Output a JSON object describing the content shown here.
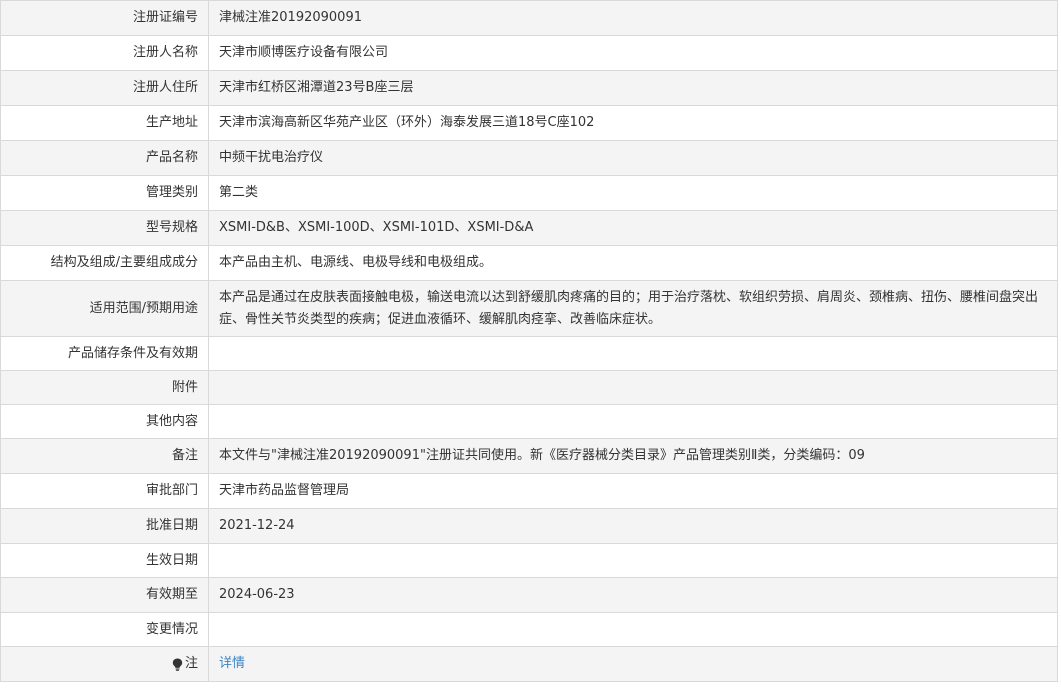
{
  "rows": [
    {
      "label": "注册证编号",
      "value": "津械注准20192090091"
    },
    {
      "label": "注册人名称",
      "value": "天津市顺博医疗设备有限公司"
    },
    {
      "label": "注册人住所",
      "value": "天津市红桥区湘潭道23号B座三层"
    },
    {
      "label": "生产地址",
      "value": "天津市滨海高新区华苑产业区（环外）海泰发展三道18号C座102"
    },
    {
      "label": "产品名称",
      "value": "中频干扰电治疗仪"
    },
    {
      "label": "管理类别",
      "value": "第二类"
    },
    {
      "label": "型号规格",
      "value": "XSMI-D&B、XSMI-100D、XSMI-101D、XSMI-D&A"
    },
    {
      "label": "结构及组成/主要组成成分",
      "value": "本产品由主机、电源线、电极导线和电极组成。"
    },
    {
      "label": "适用范围/预期用途",
      "value": "本产品是通过在皮肤表面接触电极，输送电流以达到舒缓肌肉疼痛的目的；用于治疗落枕、软组织劳损、肩周炎、颈椎病、扭伤、腰椎间盘突出症、骨性关节炎类型的疾病；促进血液循环、缓解肌肉痉挛、改善临床症状。"
    },
    {
      "label": "产品储存条件及有效期",
      "value": ""
    },
    {
      "label": "附件",
      "value": ""
    },
    {
      "label": "其他内容",
      "value": ""
    },
    {
      "label": "备注",
      "value": "本文件与\"津械注准20192090091\"注册证共同使用。新《医疗器械分类目录》产品管理类别Ⅱ类，分类编码：09"
    },
    {
      "label": "审批部门",
      "value": "天津市药品监督管理局"
    },
    {
      "label": "批准日期",
      "value": "2021-12-24"
    },
    {
      "label": "生效日期",
      "value": ""
    },
    {
      "label": "有效期至",
      "value": "2024-06-23"
    },
    {
      "label": "变更情况",
      "value": ""
    }
  ],
  "note": {
    "label": "注",
    "icon": "lightbulb-icon",
    "link_text": "详情",
    "link_color": "#3a85c6"
  }
}
